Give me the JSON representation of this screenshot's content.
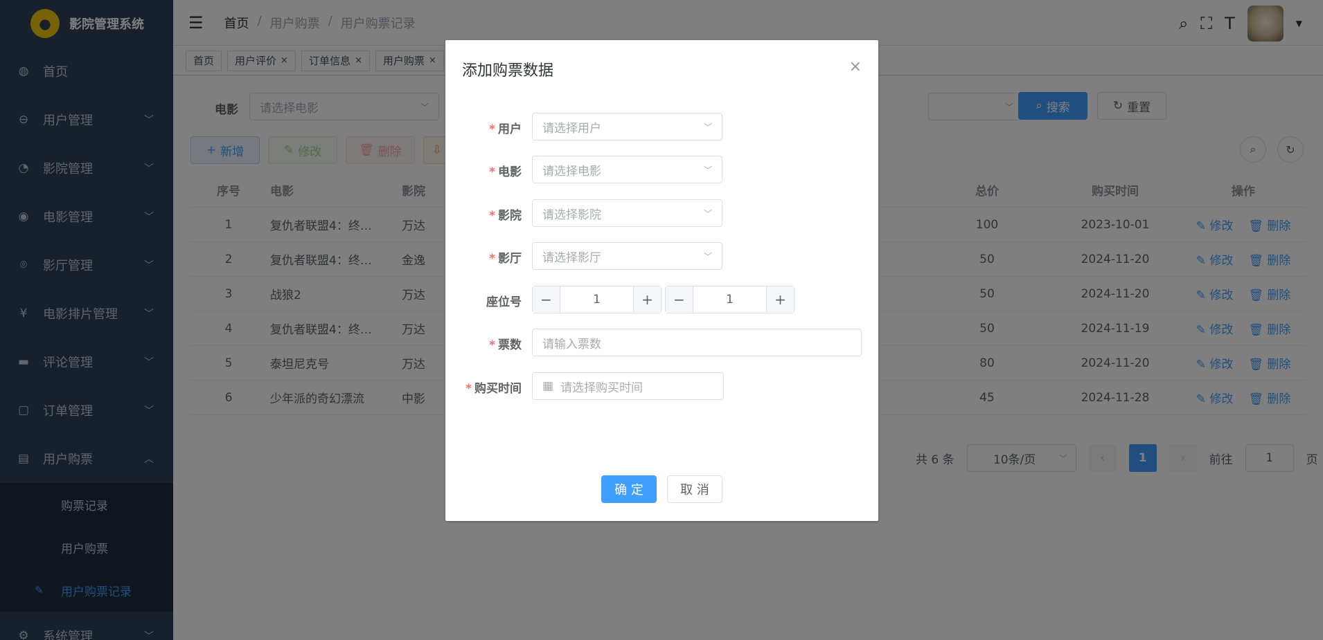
{
  "app": {
    "title": "影院管理系统",
    "logo_glyph": "●"
  },
  "sidebar": {
    "items": [
      {
        "label": "首页",
        "icon": "dashboard-icon",
        "glyph": "◍"
      },
      {
        "label": "用户管理",
        "icon": "user-group-icon",
        "glyph": "⊖"
      },
      {
        "label": "影院管理",
        "icon": "cinema-icon",
        "glyph": "◔"
      },
      {
        "label": "电影管理",
        "icon": "github-icon",
        "glyph": "◉"
      },
      {
        "label": "影厅管理",
        "icon": "location-icon",
        "glyph": "⌾"
      },
      {
        "label": "电影排片管理",
        "icon": "yen-icon",
        "glyph": "¥"
      },
      {
        "label": "评论管理",
        "icon": "comment-icon",
        "glyph": "▬"
      },
      {
        "label": "订单管理",
        "icon": "clipboard-icon",
        "glyph": "▢"
      },
      {
        "label": "用户购票",
        "icon": "cart-icon",
        "glyph": "▤"
      }
    ],
    "subitems": [
      "购票记录",
      "用户购票",
      "用户购票记录"
    ],
    "last_item": {
      "label": "系统管理",
      "glyph": "⚙"
    }
  },
  "header": {
    "breadcrumb": [
      "首页",
      "/",
      "用户购票",
      "/",
      "用户购票记录"
    ]
  },
  "tags": [
    {
      "label": "首页",
      "close": ""
    },
    {
      "label": "用户评价",
      "close": "×"
    },
    {
      "label": "订单信息",
      "close": "×"
    },
    {
      "label": "用户购票",
      "close": "×"
    }
  ],
  "filters": {
    "movie_label": "电影",
    "movie_placeholder": "请选择电影",
    "search": "搜索",
    "reset": "重置"
  },
  "toolbar": {
    "add": "新增",
    "edit": "修改",
    "delete": "删除"
  },
  "table": {
    "headers": {
      "idx": "序号",
      "movie": "电影",
      "cinema": "影院",
      "total": "总价",
      "time": "购买时间",
      "ops": "操作"
    },
    "row_edit": "修改",
    "row_delete": "删除",
    "rows": [
      {
        "idx": "1",
        "movie": "复仇者联盟4：终…",
        "cinema": "万达",
        "total": "100",
        "time": "2023-10-01"
      },
      {
        "idx": "2",
        "movie": "复仇者联盟4：终…",
        "cinema": "金逸",
        "total": "50",
        "time": "2024-11-20"
      },
      {
        "idx": "3",
        "movie": "战狼2",
        "cinema": "万达",
        "total": "50",
        "time": "2024-11-20"
      },
      {
        "idx": "4",
        "movie": "复仇者联盟4：终…",
        "cinema": "万达",
        "total": "50",
        "time": "2024-11-19"
      },
      {
        "idx": "5",
        "movie": "泰坦尼克号",
        "cinema": "万达",
        "total": "80",
        "time": "2024-11-20"
      },
      {
        "idx": "6",
        "movie": "少年派的奇幻漂流",
        "cinema": "中影",
        "total": "45",
        "time": "2024-11-28"
      }
    ]
  },
  "pagination": {
    "total": "共 6 条",
    "page_size": "10条/页",
    "current": "1",
    "goto_label": "前往",
    "goto_value": "1",
    "goto_suffix": "页"
  },
  "dialog": {
    "title": "添加购票数据",
    "fields": {
      "user": {
        "label": "用户",
        "placeholder": "请选择用户"
      },
      "movie": {
        "label": "电影",
        "placeholder": "请选择电影"
      },
      "cinema": {
        "label": "影院",
        "placeholder": "请选择影院"
      },
      "hall": {
        "label": "影厅",
        "placeholder": "请选择影厅"
      },
      "seat": {
        "label": "座位号",
        "row": "1",
        "col": "1"
      },
      "tickets": {
        "label": "票数",
        "placeholder": "请输入票数"
      },
      "time": {
        "label": "购买时间",
        "placeholder": "请选择购买时间"
      }
    },
    "confirm": "确 定",
    "cancel": "取 消"
  },
  "colors": {
    "sidebar": "#304156",
    "primary": "#409eff",
    "danger": "#f56c6c"
  }
}
